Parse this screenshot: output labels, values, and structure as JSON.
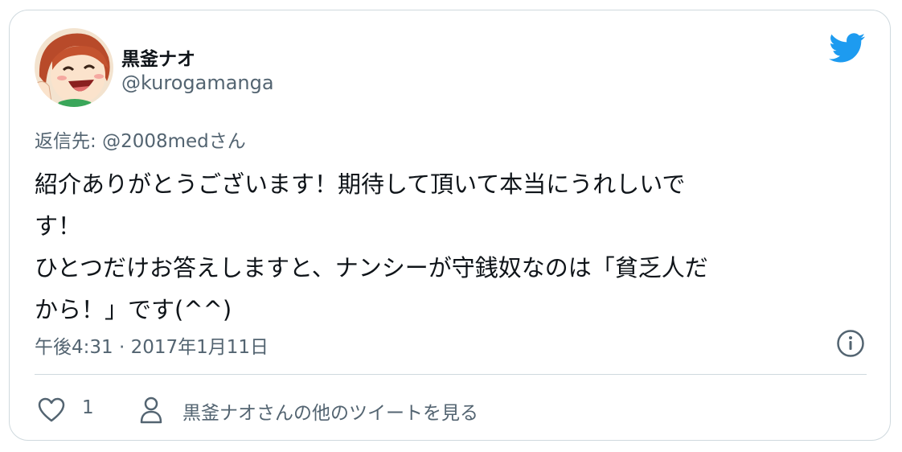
{
  "tweet": {
    "author": {
      "display_name": "黒釜ナオ",
      "handle": "@kurogamanga",
      "avatar_icon": "avatar-illustration"
    },
    "brand_icon": "twitter-bird-icon",
    "replying_to": {
      "prefix": "返信先: ",
      "mention": "@2008med",
      "suffix": "さん"
    },
    "text": "紹介ありがとうございます！期待して頂いて本当にうれしいで\nす！\nひとつだけお答えしますと、ナンシーが守銭奴なのは「貧乏人だ\nから！」です(^^)",
    "timestamp": "午後4:31 · 2017年1月11日",
    "likes": {
      "count": "1",
      "icon": "heart-icon"
    },
    "see_more": {
      "label": "黒釜ナオさんの他のツイートを見る",
      "icon": "person-icon"
    }
  },
  "colors": {
    "primary_text": "#0f1419",
    "secondary_text": "#536471",
    "border": "#cfd9de",
    "twitter_blue": "#1d9bf0"
  }
}
